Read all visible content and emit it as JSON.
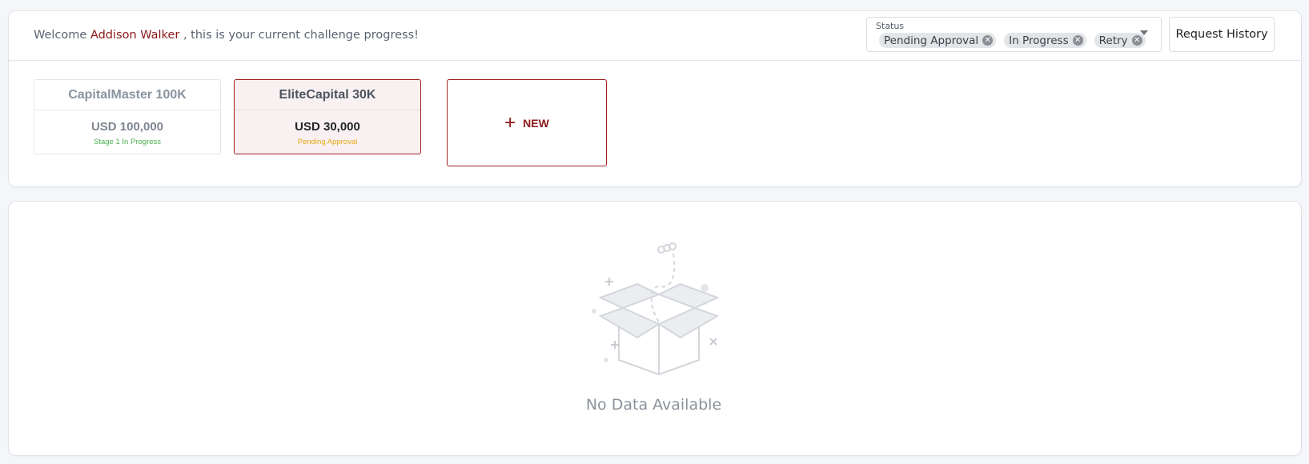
{
  "header": {
    "welcome_prefix": "Welcome",
    "user_name": "Addison Walker",
    "welcome_suffix": ", this is your current challenge progress!"
  },
  "status_filter": {
    "label": "Status",
    "chips": [
      "Pending Approval",
      "In Progress",
      "Retry"
    ]
  },
  "request_history_label": "Request History",
  "challenges": [
    {
      "title": "CapitalMaster 100K",
      "amount": "USD 100,000",
      "status": "Stage 1 In Progress"
    },
    {
      "title": "EliteCapital 30K",
      "amount": "USD 30,000",
      "status": "Pending Approval"
    }
  ],
  "new_button": {
    "icon": "plus-icon",
    "label": "NEW"
  },
  "empty_state": {
    "icon": "empty-box-icon",
    "text": "No Data Available"
  },
  "colors": {
    "brand": "#8c1a1a",
    "success": "#4caf50",
    "warning": "#e6a817"
  }
}
